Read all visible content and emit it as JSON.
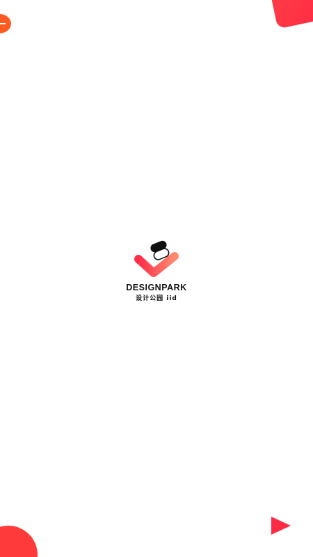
{
  "brand": {
    "name": "DESIGNPARK",
    "subtitle": "设计公园 iid"
  },
  "icons": {
    "logo": "designpark-logo-icon",
    "play": "play-triangle-icon"
  },
  "colors": {
    "background": "#ffffff",
    "accent_red": "#ff2d46",
    "accent_orange": "#ff5a1f",
    "text": "#111111"
  }
}
